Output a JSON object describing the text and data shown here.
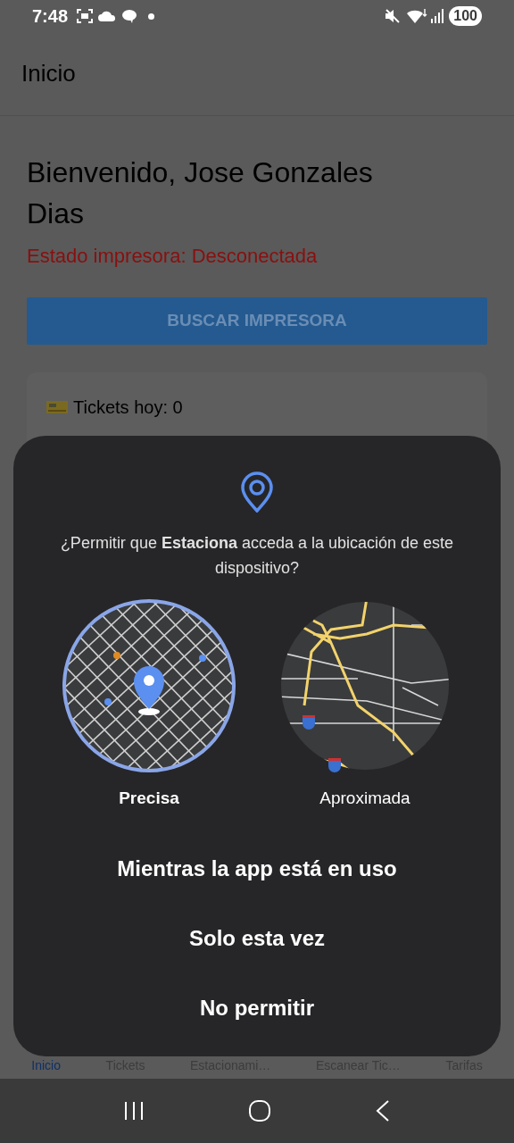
{
  "status_bar": {
    "time": "7:48",
    "battery": "100"
  },
  "app_bar": {
    "title": "Inicio"
  },
  "greeting": "Bienvenido, Jose Gonzales Dias",
  "printer_status": "Estado impresora: Desconectada",
  "search_button": "BUSCAR IMPRESORA",
  "stats_card": {
    "items": [
      {
        "label": "Tickets hoy: 0"
      }
    ]
  },
  "bottom_nav": [
    {
      "label": "Inicio",
      "selected": true
    },
    {
      "label": "Tickets",
      "selected": false
    },
    {
      "label": "Estacionami…",
      "selected": false
    },
    {
      "label": "Escanear Tic…",
      "selected": false
    },
    {
      "label": "Tarifas",
      "selected": false
    }
  ],
  "dialog": {
    "message": "¿Permitir que **Estaciona** acceda a la ubicación de este dispositivo?",
    "options": [
      {
        "kind": "precise",
        "label": "Precisa",
        "selected": true
      },
      {
        "kind": "approximate",
        "label": "Aproximada",
        "selected": false
      }
    ],
    "actions": [
      "Mientras la app está en uso",
      "Solo esta vez",
      "No permitir"
    ]
  }
}
